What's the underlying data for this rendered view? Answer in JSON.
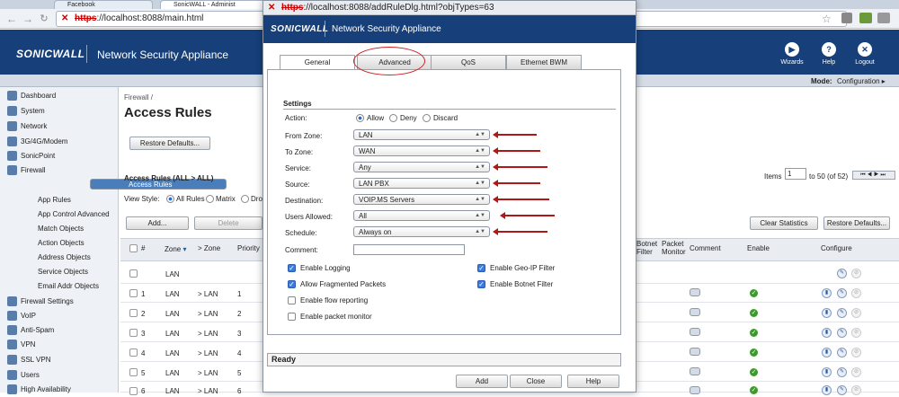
{
  "browser": {
    "tabs": [
      "Facebook",
      "SonicWALL - Administ"
    ],
    "url_scheme": "https",
    "url_rest": "://localhost:8088/main.html"
  },
  "header": {
    "logo": "SONICWALL",
    "title": "Network Security Appliance",
    "actions": [
      {
        "label": "Wizards",
        "icon": "wizard-icon"
      },
      {
        "label": "Help",
        "icon": "help-icon"
      },
      {
        "label": "Logout",
        "icon": "logout-icon"
      }
    ],
    "mode_label": "Mode:",
    "mode_value": "Configuration ▸"
  },
  "sidebar": {
    "items": [
      {
        "label": "Dashboard",
        "level": 0
      },
      {
        "label": "System",
        "level": 0
      },
      {
        "label": "Network",
        "level": 0
      },
      {
        "label": "3G/4G/Modem",
        "level": 0
      },
      {
        "label": "SonicPoint",
        "level": 0
      },
      {
        "label": "Firewall",
        "level": 0
      },
      {
        "label": "Access Rules",
        "level": 1,
        "selected": true
      },
      {
        "label": "App Rules",
        "level": 1
      },
      {
        "label": "App Control Advanced",
        "level": 1
      },
      {
        "label": "Match Objects",
        "level": 1
      },
      {
        "label": "Action Objects",
        "level": 1
      },
      {
        "label": "Address Objects",
        "level": 1
      },
      {
        "label": "Service Objects",
        "level": 1
      },
      {
        "label": "Email Addr Objects",
        "level": 1
      },
      {
        "label": "Firewall Settings",
        "level": 0
      },
      {
        "label": "VoIP",
        "level": 0
      },
      {
        "label": "Anti-Spam",
        "level": 0
      },
      {
        "label": "VPN",
        "level": 0
      },
      {
        "label": "SSL VPN",
        "level": 0
      },
      {
        "label": "Users",
        "level": 0
      },
      {
        "label": "High Availability",
        "level": 0
      }
    ]
  },
  "main": {
    "breadcrumb": "Firewall /",
    "title": "Access Rules",
    "restore_btn": "Restore Defaults...",
    "section_title": "Access Rules (ALL > ALL)",
    "items_label": "Items",
    "items_value": "1",
    "items_range": "to 50 (of 52)",
    "view_style_label": "View Style:",
    "view_options": [
      "All Rules",
      "Matrix",
      "Dro"
    ],
    "add_btn": "Add...",
    "delete_btn": "Delete",
    "clear_stats_btn": "Clear Statistics",
    "restore_defaults_btn": "Restore Defaults...",
    "columns": [
      "#",
      "Zone",
      "Zone",
      "Priority",
      "Botnet Filter",
      "Packet Monitor",
      "Comment",
      "Enable",
      "Configure"
    ],
    "group_row": {
      "zone": "LAN"
    },
    "rows": [
      {
        "num": "1",
        "from": "LAN",
        "to": "LAN",
        "priority": "1"
      },
      {
        "num": "2",
        "from": "LAN",
        "to": "LAN",
        "priority": "2"
      },
      {
        "num": "3",
        "from": "LAN",
        "to": "LAN",
        "priority": "3"
      },
      {
        "num": "4",
        "from": "LAN",
        "to": "LAN",
        "priority": "4"
      },
      {
        "num": "5",
        "from": "LAN",
        "to": "LAN",
        "priority": "5"
      },
      {
        "num": "6",
        "from": "LAN",
        "to": "LAN",
        "priority": "6"
      }
    ]
  },
  "dialog": {
    "url_scheme": "https",
    "url_rest": "://localhost:8088/addRuleDlg.html?objTypes=63",
    "logo": "SONICWALL",
    "title": "Network Security Appliance",
    "tabs": [
      "General",
      "Advanced",
      "QoS",
      "Ethernet BWM"
    ],
    "section": "Settings",
    "action_label": "Action:",
    "action_options": [
      "Allow",
      "Deny",
      "Discard"
    ],
    "fields": [
      {
        "label": "From Zone:",
        "value": "LAN"
      },
      {
        "label": "To Zone:",
        "value": "WAN"
      },
      {
        "label": "Service:",
        "value": "Any"
      },
      {
        "label": "Source:",
        "value": "LAN PBX"
      },
      {
        "label": "Destination:",
        "value": "VOIP.MS Servers"
      },
      {
        "label": "Users Allowed:",
        "value": "All"
      },
      {
        "label": "Schedule:",
        "value": "Always on"
      }
    ],
    "comment_label": "Comment:",
    "comment_value": "",
    "checks_left": [
      {
        "label": "Enable Logging",
        "checked": true
      },
      {
        "label": "Allow Fragmented Packets",
        "checked": true
      },
      {
        "label": "Enable flow reporting",
        "checked": false
      },
      {
        "label": "Enable packet monitor",
        "checked": false
      }
    ],
    "checks_right": [
      {
        "label": "Enable Geo-IP Filter",
        "checked": true
      },
      {
        "label": "Enable Botnet Filter",
        "checked": true
      }
    ],
    "status": "Ready",
    "buttons": [
      "Add",
      "Close",
      "Help"
    ]
  }
}
